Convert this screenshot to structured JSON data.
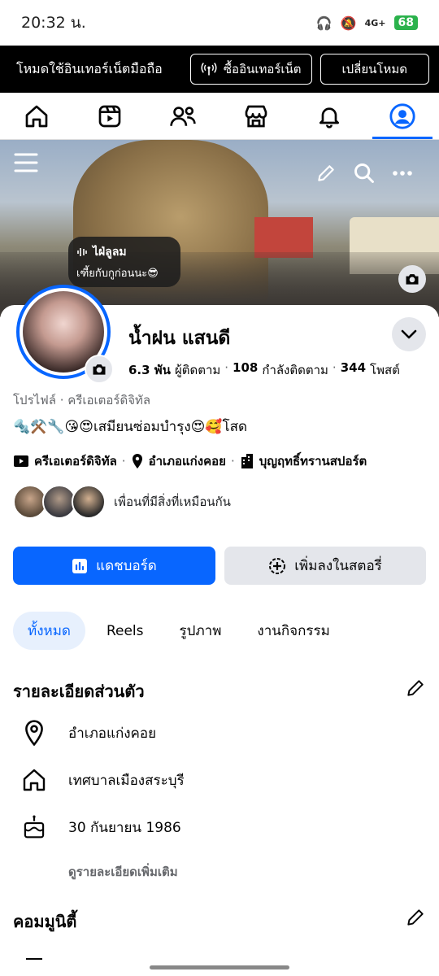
{
  "status_bar": {
    "time": "20:32 น.",
    "network": "4G+",
    "battery": "68"
  },
  "net_banner": {
    "text": "โหมดใช้อินเทอร์เน็ตมือถือ",
    "buy_label": "ซื้ออินเทอร์เน็ต",
    "switch_label": "เปลี่ยนโหมด"
  },
  "tabs": [
    {
      "icon": "home-icon"
    },
    {
      "icon": "reels-icon"
    },
    {
      "icon": "friends-icon"
    },
    {
      "icon": "marketplace-icon"
    },
    {
      "icon": "bell-icon"
    },
    {
      "icon": "profile-icon",
      "active": true
    }
  ],
  "note": {
    "title": "ไฝ่ลูลม",
    "text": "เฑี้ยกับกูก่อนนะ😎"
  },
  "profile": {
    "name": "น้ำฝน แสนดี",
    "followers": "6.3 พัน",
    "followers_label": "ผู้ติดตาม",
    "following": "108",
    "following_label": "กำลังติดตาม",
    "posts": "344",
    "posts_label": "โพสต์",
    "category": "โปรไฟล์ · ครีเอเตอร์ดิจิทัล",
    "bio": "🔩⚒️🔧😘😍เสมียนซ่อมบำรุง😍🥰โสด",
    "info": [
      {
        "icon": "creator-icon",
        "text": "ครีเอเตอร์ดิจิทัล"
      },
      {
        "icon": "location-pin-icon",
        "text": "อำเภอแก่งคอย"
      },
      {
        "icon": "workplace-icon",
        "text": "บุญฤทธิ์ทรานสปอร์ต"
      }
    ],
    "mutual_label": "เพื่อนที่มีสิ่งที่เหมือนกัน"
  },
  "actions": {
    "dashboard": "แดชบอร์ด",
    "add_story": "เพิ่มลงในสตอรี่"
  },
  "filters": [
    "ทั้งหมด",
    "Reels",
    "รูปภาพ",
    "งานกิจกรรม"
  ],
  "details": {
    "title": "รายละเอียดส่วนตัว",
    "items": [
      {
        "icon": "location-pin-icon",
        "text": "อำเภอแก่งคอย"
      },
      {
        "icon": "house-icon",
        "text": "เทศบาลเมืองสระบุรี"
      },
      {
        "icon": "birthday-cake-icon",
        "text": "30 กันยายน 1986"
      }
    ],
    "more": "ดูรายละเอียดเพิ่มเติม"
  },
  "community": {
    "title": "คอมมูนิตี้"
  },
  "colors": {
    "accent": "#0866ff",
    "banner": "#000000"
  }
}
